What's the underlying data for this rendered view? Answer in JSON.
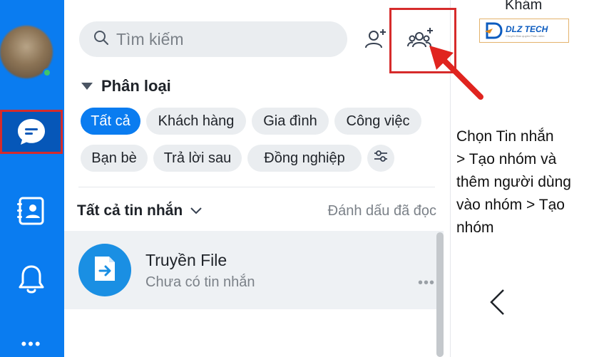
{
  "search": {
    "placeholder": "Tìm kiếm"
  },
  "category": {
    "title": "Phân loại"
  },
  "filters": [
    {
      "label": "Tất cả",
      "active": true
    },
    {
      "label": "Khách hàng",
      "active": false
    },
    {
      "label": "Gia đình",
      "active": false
    },
    {
      "label": "Công việc",
      "active": false
    },
    {
      "label": "Bạn bè",
      "active": false
    },
    {
      "label": "Trả lời sau",
      "active": false
    },
    {
      "label": "Đồng nghiệp",
      "active": false
    }
  ],
  "messages": {
    "title": "Tất cả tin nhắn",
    "mark_read": "Đánh dấu đã đọc"
  },
  "conversation": {
    "name": "Truyền File",
    "preview": "Chưa có tin nhắn",
    "more": "•••"
  },
  "nav": {
    "more": "•••"
  },
  "right_panel": {
    "cut_title": "Khám",
    "brand_name": "DLZ TECH",
    "brand_tagline": "Chuyên Bản quyền Phần mềm",
    "instruction_lines": [
      "Chọn Tin nhắn",
      "> Tạo nhóm và",
      "thêm người dùng",
      "vào nhóm > Tạo",
      "nhóm"
    ]
  },
  "icons": {
    "search": "search-icon",
    "add_friend": "add-friend-icon",
    "create_group": "create-group-icon",
    "chat": "chat-bubble-icon",
    "contacts": "contacts-icon",
    "bell": "bell-icon",
    "filter_settings": "filter-settings-icon",
    "file_transfer": "file-transfer-icon"
  },
  "colors": {
    "accent": "#0a7cf0",
    "rail_active": "#0657b8",
    "highlight_red": "#d62b2b",
    "chip_bg": "#eaedf0"
  }
}
